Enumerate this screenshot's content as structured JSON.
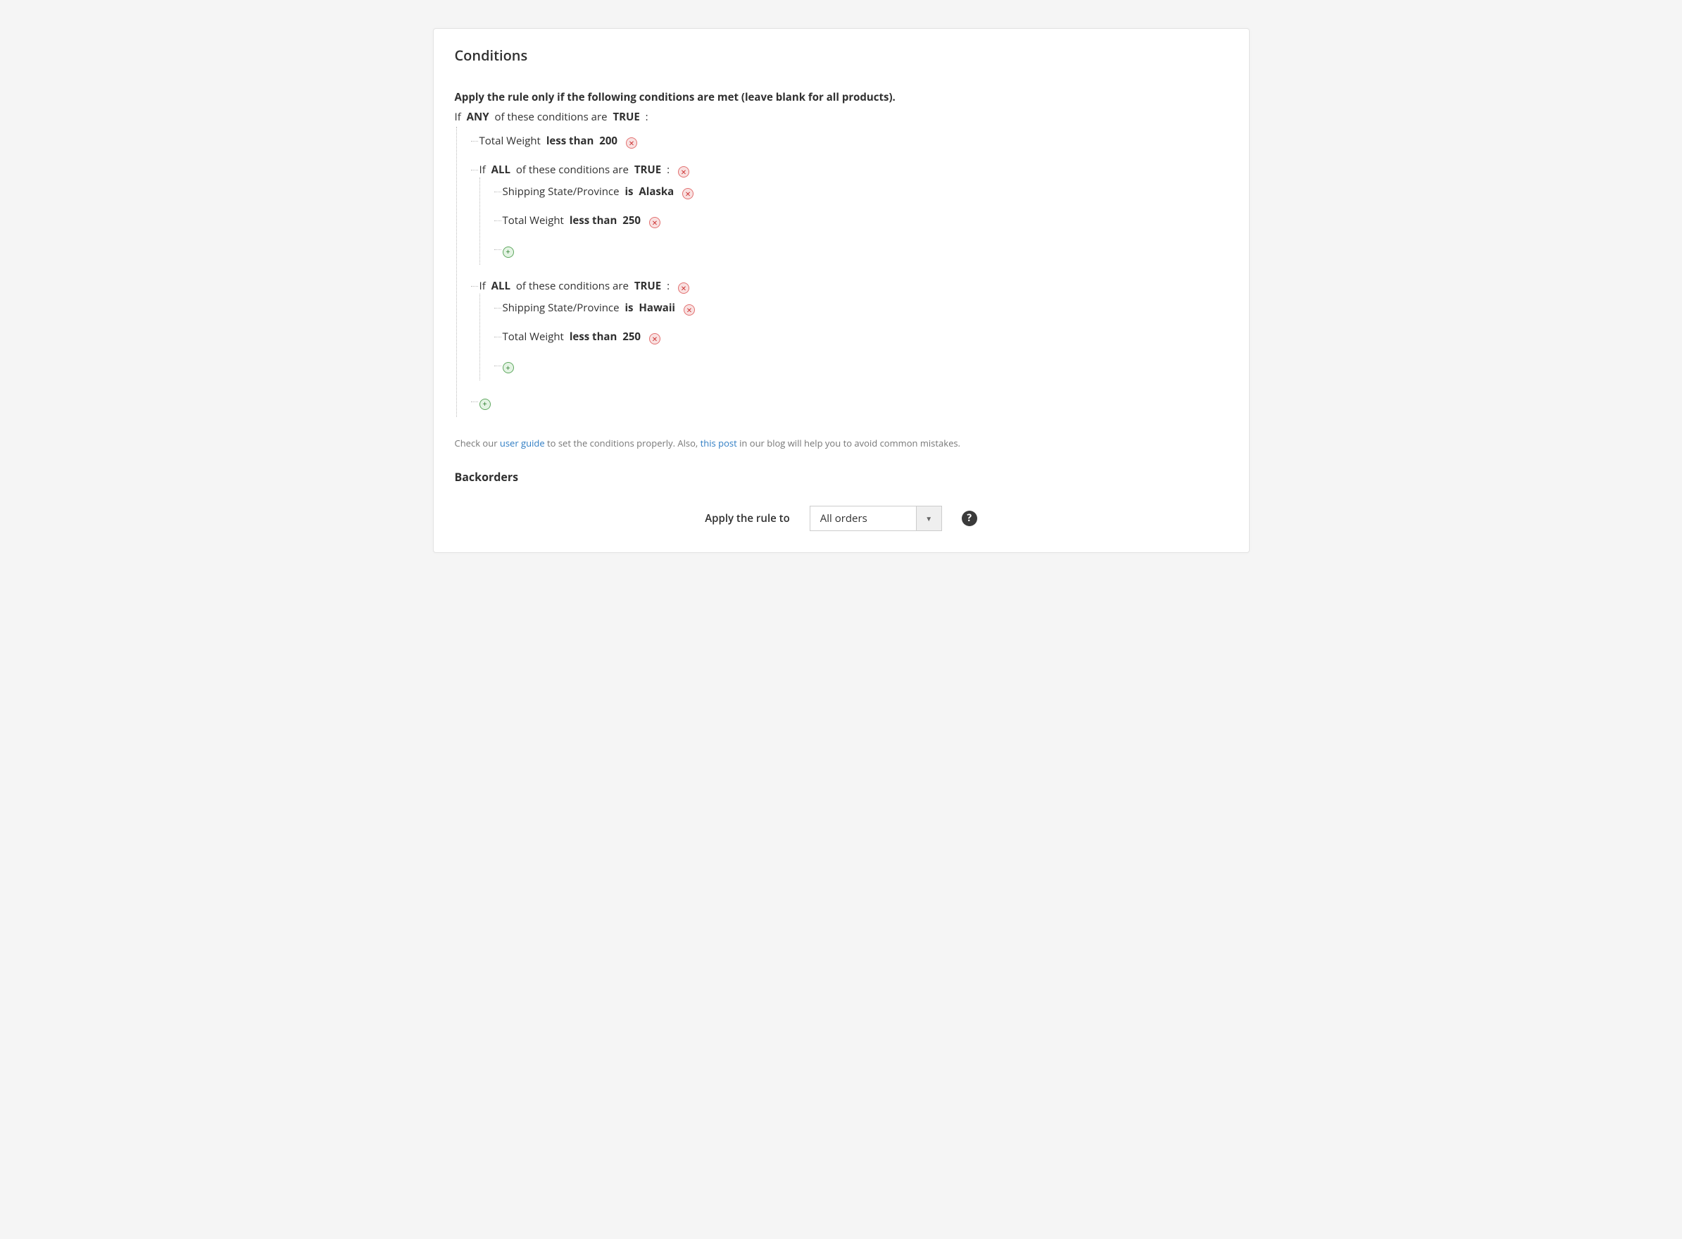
{
  "panel": {
    "title": "Conditions",
    "instruction": "Apply the rule only if the following conditions are met (leave blank for all products)."
  },
  "root": {
    "prefix_if": "If",
    "aggregator": "ANY",
    "mid": " of these conditions are ",
    "bool": "TRUE",
    "suffix": " :"
  },
  "c1": {
    "attr": "Total Weight",
    "op": "less than",
    "val": "200"
  },
  "g1": {
    "prefix_if": "If",
    "aggregator": "ALL",
    "mid": " of these conditions are ",
    "bool": "TRUE",
    "suffix": " :",
    "c1": {
      "attr": "Shipping State/Province",
      "op": "is",
      "val": "Alaska"
    },
    "c2": {
      "attr": "Total Weight",
      "op": "less than",
      "val": "250"
    }
  },
  "g2": {
    "prefix_if": "If",
    "aggregator": "ALL",
    "mid": " of these conditions are ",
    "bool": "TRUE",
    "suffix": " :",
    "c1": {
      "attr": "Shipping State/Province",
      "op": "is",
      "val": "Hawaii"
    },
    "c2": {
      "attr": "Total Weight",
      "op": "less than",
      "val": "250"
    }
  },
  "hint": {
    "p1": "Check our ",
    "link1": "user guide",
    "p2": " to set the conditions properly. Also, ",
    "link2": "this post",
    "p3": " in our blog will help you to avoid common mistakes."
  },
  "backorders": {
    "title": "Backorders",
    "label": "Apply the rule to",
    "selected": "All orders"
  }
}
